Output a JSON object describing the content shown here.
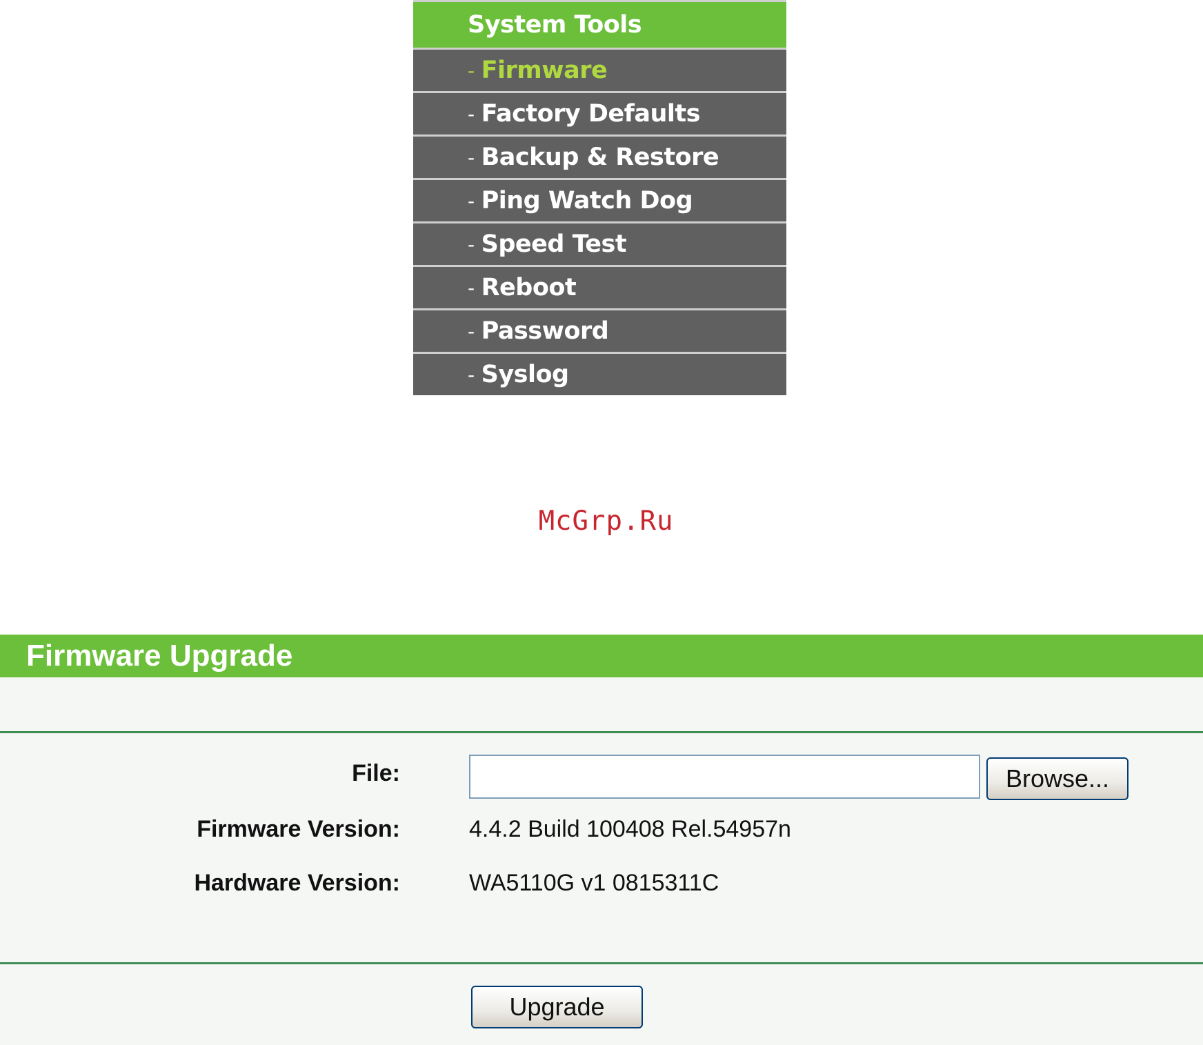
{
  "menu": {
    "header": "System Tools",
    "dash": "-",
    "items": [
      {
        "label": "Firmware",
        "active": true
      },
      {
        "label": "Factory Defaults",
        "active": false
      },
      {
        "label": "Backup & Restore",
        "active": false
      },
      {
        "label": "Ping Watch Dog",
        "active": false
      },
      {
        "label": "Speed Test",
        "active": false
      },
      {
        "label": "Reboot",
        "active": false
      },
      {
        "label": "Password",
        "active": false
      },
      {
        "label": "Syslog",
        "active": false
      }
    ]
  },
  "watermark": "McGrp.Ru",
  "panel": {
    "title": "Firmware Upgrade",
    "file_label": "File:",
    "file_value": "",
    "browse_label": "Browse...",
    "firmware_label": "Firmware Version:",
    "firmware_value": "4.4.2 Build 100408 Rel.54957n",
    "hardware_label": "Hardware Version:",
    "hardware_value": "WA5110G v1 0815311C",
    "upgrade_label": "Upgrade"
  },
  "colors": {
    "green_header": "#6cbf3a",
    "menu_item_bg": "#606060",
    "active_item_text": "#b0d840",
    "divider": "#3e8e53",
    "watermark": "#c7262e"
  }
}
